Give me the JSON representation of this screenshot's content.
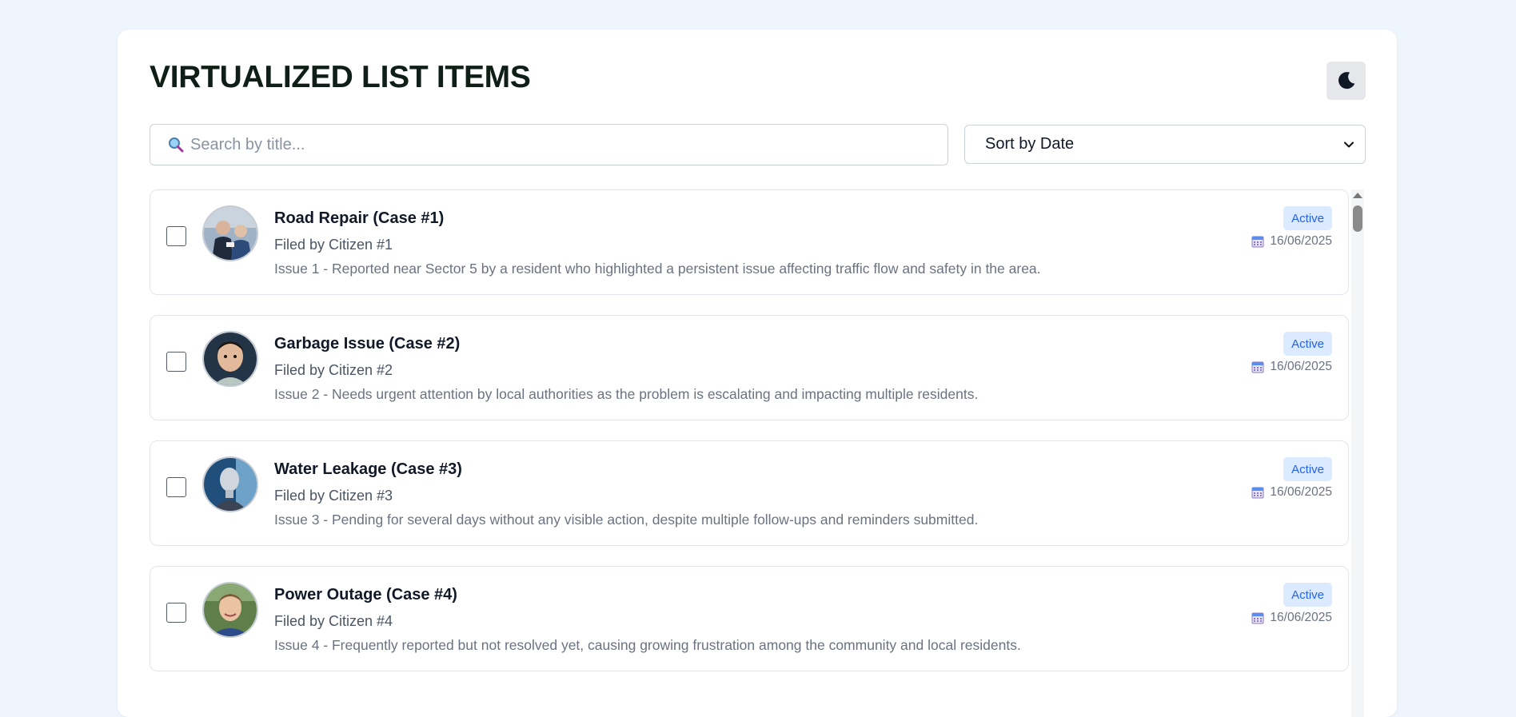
{
  "page": {
    "title": "VIRTUALIZED LIST ITEMS"
  },
  "header": {
    "theme_toggle_icon": "moon-icon"
  },
  "search": {
    "placeholder": "Search by title...",
    "value": "",
    "icon": "search-icon"
  },
  "sort": {
    "selected": "Sort by Date",
    "icon": "chevron-down-icon"
  },
  "colors": {
    "accent": "#2563eb",
    "badge_bg": "#dbeafe",
    "background": "#eef5fd"
  },
  "items": [
    {
      "title": "Road Repair (Case #1)",
      "filed_by": "Filed by Citizen #1",
      "description": "Issue 1 - Reported near Sector 5 by a resident who highlighted a persistent issue affecting traffic flow and safety in the area.",
      "status": "Active",
      "date": "16/06/2025",
      "checked": false
    },
    {
      "title": "Garbage Issue (Case #2)",
      "filed_by": "Filed by Citizen #2",
      "description": "Issue 2 - Needs urgent attention by local authorities as the problem is escalating and impacting multiple residents.",
      "status": "Active",
      "date": "16/06/2025",
      "checked": false
    },
    {
      "title": "Water Leakage (Case #3)",
      "filed_by": "Filed by Citizen #3",
      "description": "Issue 3 - Pending for several days without any visible action, despite multiple follow-ups and reminders submitted.",
      "status": "Active",
      "date": "16/06/2025",
      "checked": false
    },
    {
      "title": "Power Outage (Case #4)",
      "filed_by": "Filed by Citizen #4",
      "description": "Issue 4 - Frequently reported but not resolved yet, causing growing frustration among the community and local residents.",
      "status": "Active",
      "date": "16/06/2025",
      "checked": false
    }
  ]
}
